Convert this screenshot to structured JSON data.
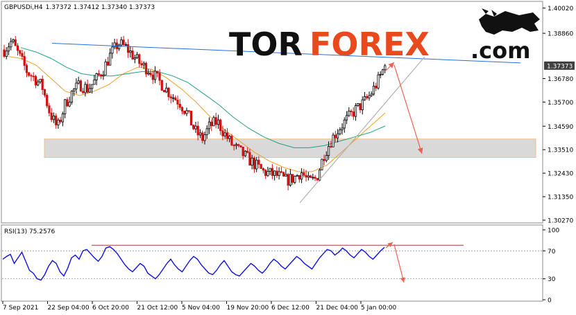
{
  "header": {
    "symbol": "GBPUSDi,H4",
    "ohlc": "1.37372 1.37412 1.37340 1.37373"
  },
  "logo": {
    "part1": "TOR",
    "part2": "FOREX",
    "part3": ".com"
  },
  "rsi_panel": {
    "label": "RSI(13) 75.2576",
    "levels": [
      "100",
      "70",
      "30",
      "0"
    ]
  },
  "colors": {
    "bull_candle": "#000000",
    "bear_candle": "#d01010",
    "ma_fast": "#f0a020",
    "ma_slow": "#20a080",
    "trendline": "#2070e0",
    "support_line": "#b0b0b0",
    "zone_fill": "#d9d9d9",
    "zone_border": "#f0c080",
    "forecast_arrow": "#f06050",
    "rsi_line": "#1010e0",
    "rsi_resistance": "#a04040",
    "current_price_box": "#404040"
  },
  "chart_data": {
    "type": "candlestick",
    "symbol": "GBPUSD",
    "timeframe": "H4",
    "price_axis": {
      "ylim": [
        1.3027,
        1.402
      ],
      "ticks": [
        "1.40020",
        "1.38860",
        "1.37373",
        "1.36780",
        "1.35700",
        "1.34590",
        "1.33510",
        "1.32430",
        "1.31350",
        "1.30270"
      ],
      "current_price": "1.37373"
    },
    "time_axis": {
      "ticks": [
        "7 Sep 2021",
        "22 Sep 04:00",
        "6 Oct 20:00",
        "21 Oct 12:00",
        "5 Nov 04:00",
        "19 Nov 20:00",
        "6 Dec 12:00",
        "21 Dec 04:00",
        "5 Jan 00:00"
      ]
    },
    "close_path": [
      1.381,
      1.385,
      1.378,
      1.371,
      1.368,
      1.364,
      1.352,
      1.345,
      1.356,
      1.362,
      1.365,
      1.363,
      1.367,
      1.372,
      1.379,
      1.384,
      1.382,
      1.378,
      1.374,
      1.372,
      1.368,
      1.364,
      1.36,
      1.357,
      1.352,
      1.344,
      1.34,
      1.346,
      1.348,
      1.342,
      1.337,
      1.334,
      1.331,
      1.328,
      1.325,
      1.324,
      1.323,
      1.321,
      1.322,
      1.325,
      1.32,
      1.322,
      1.333,
      1.34,
      1.345,
      1.349,
      1.353,
      1.356,
      1.36,
      1.366,
      1.3737
    ],
    "ma_fast": [
      1.378,
      1.377,
      1.374,
      1.368,
      1.362,
      1.36,
      1.362,
      1.365,
      1.37,
      1.373,
      1.372,
      1.368,
      1.363,
      1.357,
      1.35,
      1.344,
      1.339,
      1.334,
      1.33,
      1.327,
      1.325,
      1.325,
      1.328,
      1.334,
      1.34,
      1.346,
      1.352
    ],
    "ma_slow": [
      1.382,
      1.38,
      1.377,
      1.373,
      1.37,
      1.369,
      1.369,
      1.37,
      1.371,
      1.371,
      1.369,
      1.366,
      1.361,
      1.356,
      1.35,
      1.345,
      1.341,
      1.338,
      1.336,
      1.336,
      1.337,
      1.339,
      1.341,
      1.343,
      1.346
    ],
    "resistance_trendline": {
      "from": 1.384,
      "to": 1.375
    },
    "support_zone": [
      1.3315,
      1.34
    ],
    "rsi": {
      "ylim": [
        0,
        100
      ],
      "levels": [
        30,
        70
      ],
      "last_value": 75.2576,
      "values": [
        58,
        62,
        65,
        52,
        60,
        68,
        55,
        42,
        38,
        30,
        28,
        36,
        48,
        56,
        52,
        40,
        34,
        45,
        60,
        64,
        58,
        70,
        72,
        66,
        60,
        55,
        62,
        74,
        76,
        72,
        66,
        58,
        50,
        44,
        40,
        46,
        52,
        48,
        38,
        34,
        30,
        36,
        44,
        52,
        58,
        50,
        44,
        40,
        48,
        56,
        62,
        58,
        50,
        44,
        38,
        36,
        42,
        50,
        56,
        48,
        40,
        36,
        34,
        40,
        46,
        52,
        48,
        42,
        38,
        44,
        52,
        58,
        54,
        48,
        44,
        50,
        56,
        62,
        58,
        52,
        48,
        44,
        52,
        60,
        66,
        72,
        70,
        64,
        68,
        74,
        70,
        64,
        60,
        66,
        72,
        68,
        62,
        58,
        64,
        70,
        75
      ]
    }
  }
}
